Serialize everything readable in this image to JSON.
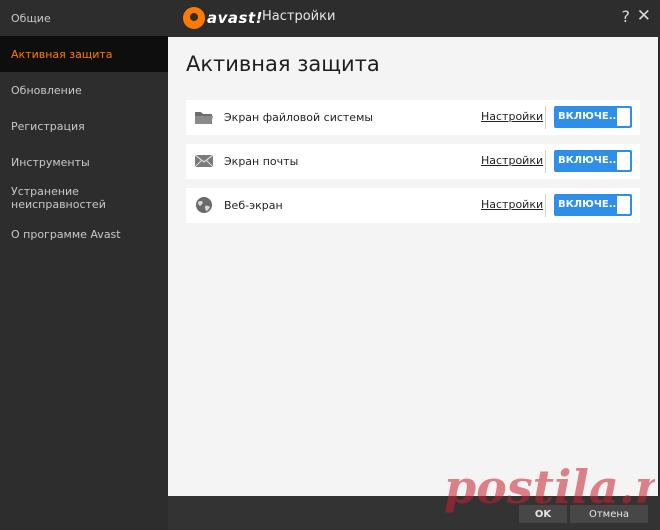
{
  "sidebar": {
    "items": [
      {
        "label": "Общие",
        "active": false
      },
      {
        "label": "Активная защита",
        "active": true
      },
      {
        "label": "Обновление",
        "active": false
      },
      {
        "label": "Регистрация",
        "active": false
      },
      {
        "label": "Инструменты",
        "active": false
      },
      {
        "label": "Устранение неисправностей",
        "active": false
      },
      {
        "label": "О программе Avast",
        "active": false
      }
    ]
  },
  "titlebar": {
    "logo_text": "avast!",
    "title": "Настройки",
    "help_glyph": "?",
    "close_glyph": "✕"
  },
  "main": {
    "title": "Активная защита",
    "shields": [
      {
        "name": "Экран файловой системы",
        "settings_label": "Настройки",
        "toggle_label": "ВКЛЮЧЕ...",
        "icon": "folder-icon"
      },
      {
        "name": "Экран почты",
        "settings_label": "Настройки",
        "toggle_label": "ВКЛЮЧЕ...",
        "icon": "mail-icon"
      },
      {
        "name": "Веб-экран",
        "settings_label": "Настройки",
        "toggle_label": "ВКЛЮЧЕ...",
        "icon": "globe-icon"
      }
    ]
  },
  "footer": {
    "ok_label": "OK",
    "cancel_label": "Отмена"
  },
  "watermark": {
    "text": "postila.ru"
  },
  "colors": {
    "accent": "#ff7a00",
    "toggle_on": "#2f8ee8",
    "sidebar_bg": "#2d2d2d",
    "content_bg": "#f4f4f4"
  }
}
